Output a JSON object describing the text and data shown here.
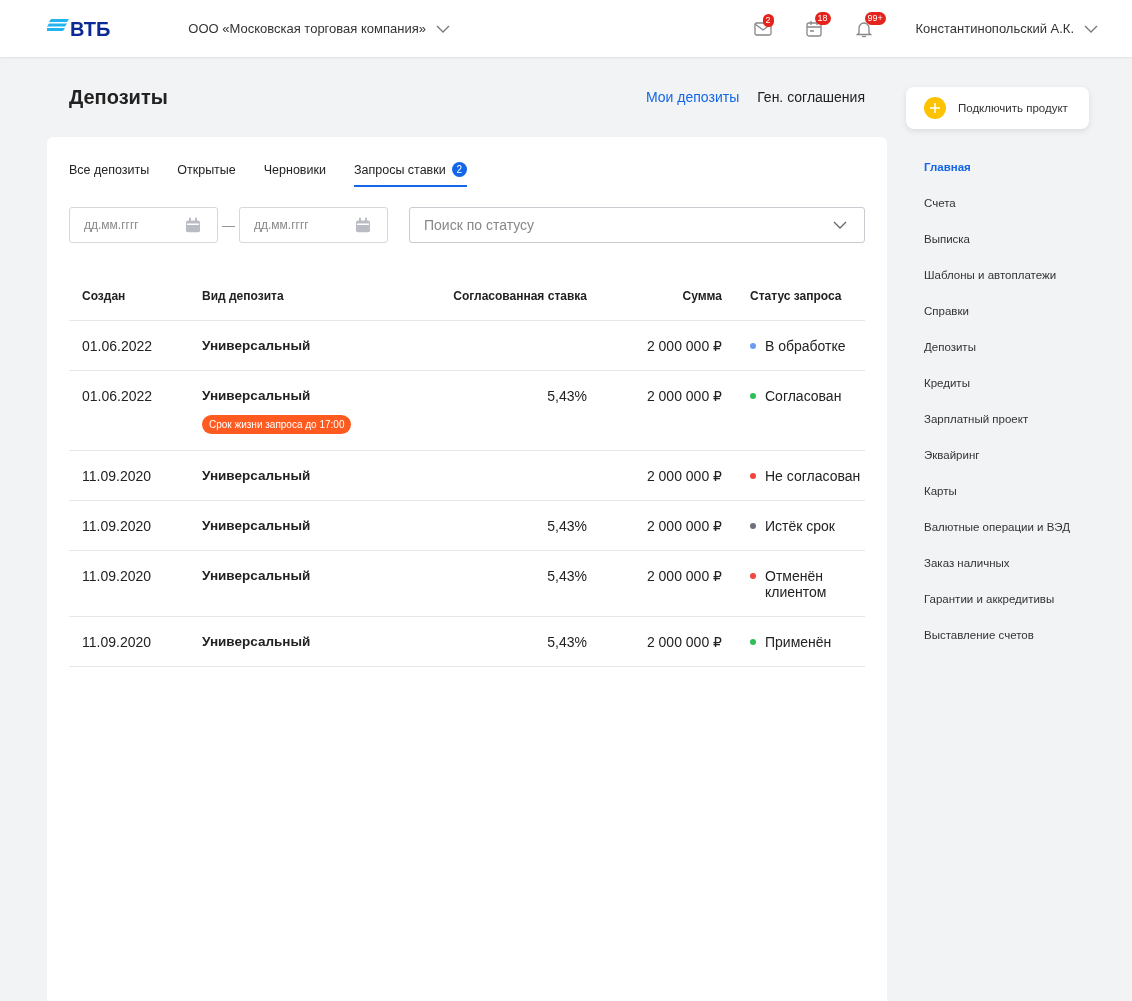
{
  "header": {
    "logo": "ВТБ",
    "company": "ООО «Московская торговая компания»",
    "notifications": [
      {
        "kind": "mail",
        "count": "2"
      },
      {
        "kind": "calendar",
        "count": "18"
      },
      {
        "kind": "bell",
        "count": "99+"
      }
    ],
    "user": "Константинопольский А.К."
  },
  "page": {
    "title": "Депозиты",
    "links": [
      {
        "label": "Мои депозиты",
        "selected": true
      },
      {
        "label": "Ген. соглашения",
        "selected": false
      }
    ]
  },
  "tabs": [
    {
      "label": "Все депозиты",
      "selected": false
    },
    {
      "label": "Открытые",
      "selected": false
    },
    {
      "label": "Черновики",
      "selected": false
    },
    {
      "label": "Запросы ставки",
      "selected": true,
      "badge": "2"
    }
  ],
  "filters": {
    "date_from": {
      "placeholder": "дд.мм.гггг"
    },
    "date_separator": "—",
    "date_to": {
      "placeholder": "дд.мм.гггг"
    },
    "status": {
      "placeholder": "Поиск по статусу"
    }
  },
  "table": {
    "columns": [
      "Создан",
      "Вид депозита",
      "Согласованная ставка",
      "Сумма",
      "Статус запроса"
    ],
    "rows": [
      {
        "created": "01.06.2022",
        "type": "Универсальный",
        "rate": "",
        "sum": "2 000 000 ₽",
        "status": "В обработке",
        "color": "#6b9bf5"
      },
      {
        "created": "01.06.2022",
        "type": "Универсальный",
        "tag": "Срок жизни запроса до 17:00",
        "rate": "5,43%",
        "sum": "2 000 000 ₽",
        "status": "Согласован",
        "color": "#2ebd59"
      },
      {
        "created": "11.09.2020",
        "type": "Универсальный",
        "rate": "",
        "sum": "2 000 000 ₽",
        "status": "Не согласован",
        "color": "#f0443c"
      },
      {
        "created": "11.09.2020",
        "type": "Универсальный",
        "rate": "5,43%",
        "sum": "2 000 000 ₽",
        "status": "Истёк срок",
        "color": "#6b7079"
      },
      {
        "created": "11.09.2020",
        "type": "Универсальный",
        "rate": "5,43%",
        "sum": "2 000 000 ₽",
        "status": "Отменён клиентом",
        "color": "#f0443c"
      },
      {
        "created": "11.09.2020",
        "type": "Универсальный",
        "rate": "5,43%",
        "sum": "2 000 000 ₽",
        "status": "Применён",
        "color": "#2ebd59"
      }
    ]
  },
  "sidebar": {
    "action": "Подключить продукт",
    "items": [
      {
        "label": "Главная",
        "selected": true
      },
      {
        "label": "Счета",
        "selected": false
      },
      {
        "label": "Выписка",
        "selected": false
      },
      {
        "label": "Шаблоны и автоплатежи",
        "selected": false
      },
      {
        "label": "Справки",
        "selected": false
      },
      {
        "label": "Депозиты",
        "selected": false
      },
      {
        "label": "Кредиты",
        "selected": false
      },
      {
        "label": "Зарплатный проект",
        "selected": false
      },
      {
        "label": "Эквайринг",
        "selected": false
      },
      {
        "label": "Карты",
        "selected": false
      },
      {
        "label": "Валютные операции и ВЭД",
        "selected": false
      },
      {
        "label": "Заказ наличных",
        "selected": false
      },
      {
        "label": "Гарантии и аккредитивы",
        "selected": false
      },
      {
        "label": "Выставление счетов",
        "selected": false
      }
    ]
  }
}
